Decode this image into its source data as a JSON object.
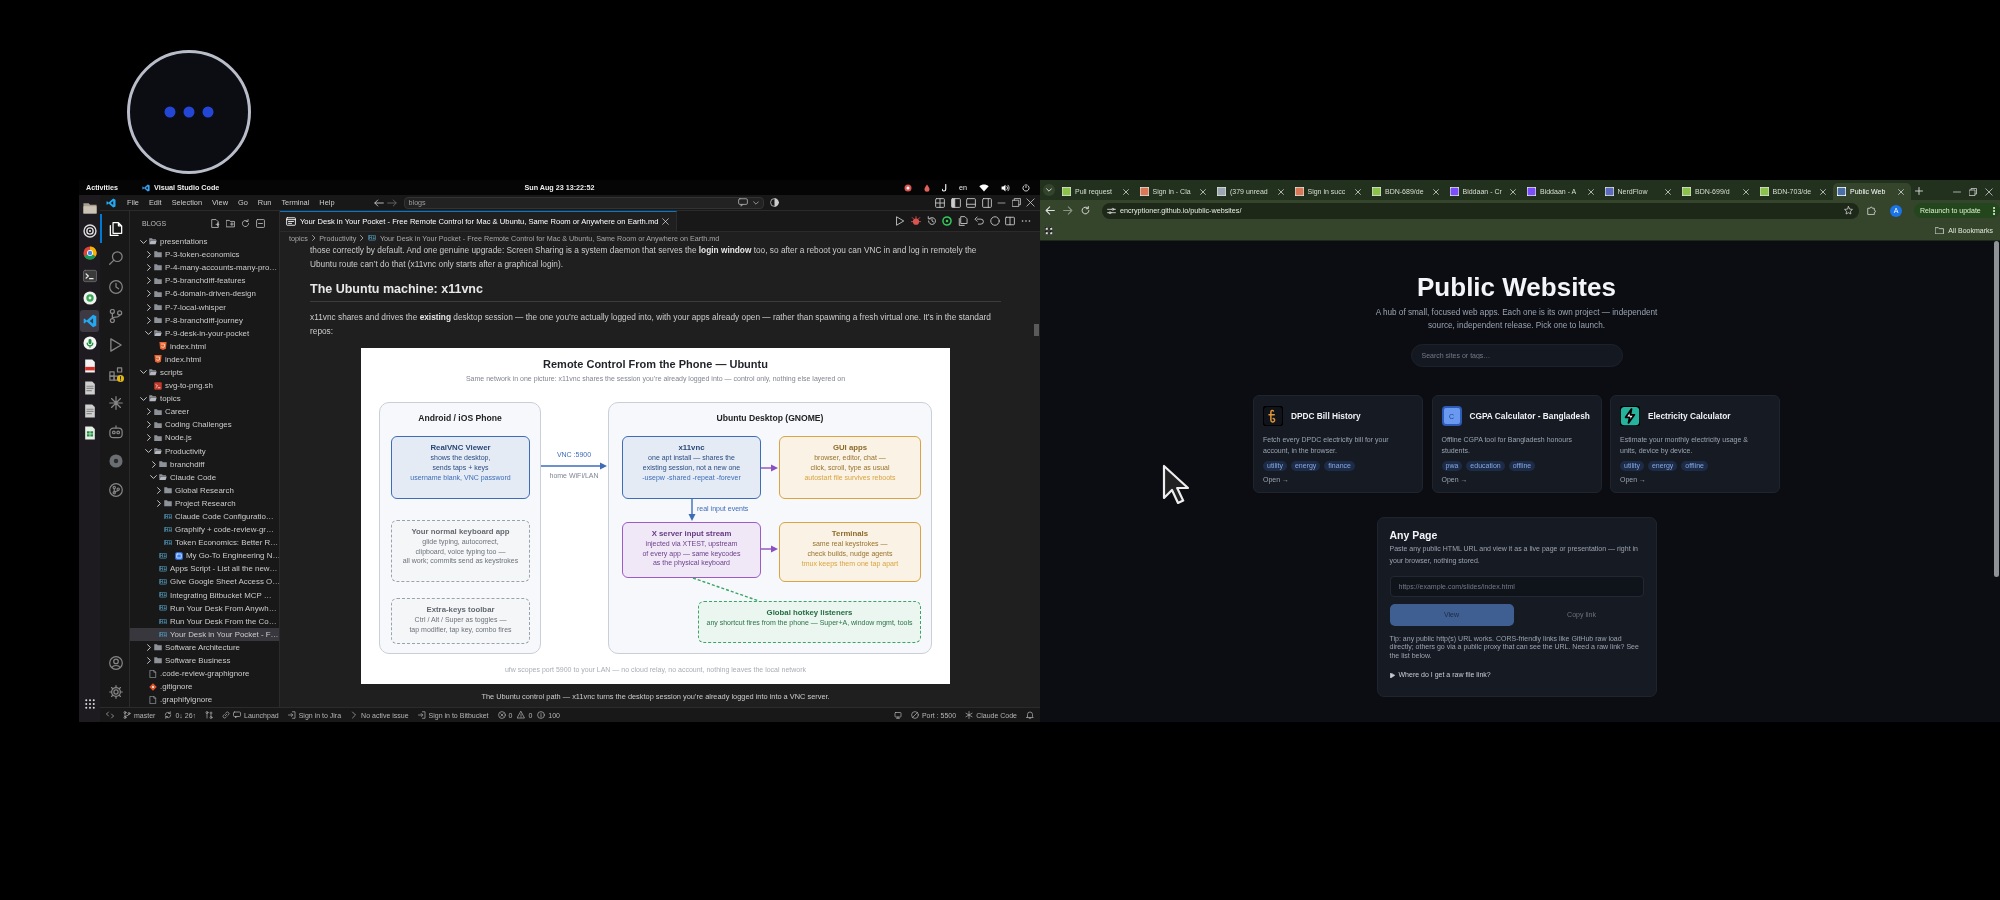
{
  "topbar": {
    "activities": "Activities",
    "app": "Visual Studio Code",
    "clock": "Sun Aug 23  13:22:52",
    "input_source": "en"
  },
  "dock": [
    {
      "kind": "folder",
      "selected": false
    },
    {
      "kind": "ring",
      "selected": false
    },
    {
      "kind": "wheel",
      "selected": false
    },
    {
      "kind": "terminal",
      "selected": false
    },
    {
      "kind": "disc",
      "selected": false
    },
    {
      "kind": "editor",
      "selected": true
    },
    {
      "kind": "mic",
      "selected": false
    },
    {
      "kind": "pdf",
      "selected": false
    },
    {
      "kind": "page",
      "selected": false
    },
    {
      "kind": "page",
      "selected": false
    },
    {
      "kind": "sheet",
      "selected": false
    }
  ],
  "vscode": {
    "menu": [
      "File",
      "Edit",
      "Selection",
      "View",
      "Go",
      "Run",
      "Terminal",
      "Help"
    ],
    "command_center": "blogs",
    "activity_bar": {
      "top": [
        {
          "kind": "explorer",
          "selected": true
        },
        {
          "kind": "search",
          "selected": false
        },
        {
          "kind": "clock",
          "selected": false
        },
        {
          "kind": "branch",
          "selected": false
        },
        {
          "kind": "run",
          "selected": false
        },
        {
          "kind": "extensions",
          "selected": false
        },
        {
          "kind": "asterisk",
          "selected": false
        },
        {
          "kind": "robot",
          "selected": false
        },
        {
          "kind": "disc",
          "selected": false
        },
        {
          "kind": "graph",
          "selected": false
        }
      ],
      "bottom": [
        {
          "kind": "account"
        },
        {
          "kind": "settings"
        }
      ]
    },
    "explorer": {
      "title": "BLOGS",
      "tree": [
        {
          "label": "presentations",
          "kind": "folder",
          "expanded": true,
          "selected": false,
          "children": [
            {
              "label": "P-3-token-economics",
              "kind": "folder",
              "expanded": false,
              "selected": false
            },
            {
              "label": "P-4-many-accounts-many-pro…",
              "kind": "folder",
              "expanded": false,
              "selected": false
            },
            {
              "label": "P-5-branchdiff-features",
              "kind": "folder",
              "expanded": false,
              "selected": false
            },
            {
              "label": "P-6-domain-driven-design",
              "kind": "folder",
              "expanded": false,
              "selected": false
            },
            {
              "label": "P-7-local-whisper",
              "kind": "folder",
              "expanded": false,
              "selected": false
            },
            {
              "label": "P-8-branchdiff-journey",
              "kind": "folder",
              "expanded": false,
              "selected": false
            },
            {
              "label": "P-9-desk-in-your-pocket",
              "kind": "folder",
              "expanded": true,
              "selected": false,
              "children": [
                {
                  "label": "index.html",
                  "kind": "html",
                  "selected": false
                }
              ]
            },
            {
              "label": "index.html",
              "kind": "html",
              "selected": false
            }
          ]
        },
        {
          "label": "scripts",
          "kind": "folder",
          "expanded": true,
          "selected": false,
          "children": [
            {
              "label": "svg-to-png.sh",
              "kind": "shell",
              "selected": false
            }
          ]
        },
        {
          "label": "topics",
          "kind": "folder",
          "expanded": true,
          "selected": false,
          "children": [
            {
              "label": "Career",
              "kind": "folder",
              "expanded": false,
              "selected": false
            },
            {
              "label": "Coding Challenges",
              "kind": "folder",
              "expanded": false,
              "selected": false
            },
            {
              "label": "Node.js",
              "kind": "folder",
              "expanded": false,
              "selected": false
            },
            {
              "label": "Productivity",
              "kind": "folder",
              "expanded": true,
              "selected": false,
              "children": [
                {
                  "label": "branchdiff",
                  "kind": "folder",
                  "expanded": false,
                  "selected": false
                },
                {
                  "label": "Claude Code",
                  "kind": "folder",
                  "expanded": true,
                  "selected": false,
                  "children": [
                    {
                      "label": "Global Research",
                      "kind": "folder",
                      "expanded": false,
                      "selected": false
                    },
                    {
                      "label": "Project Research",
                      "kind": "folder",
                      "expanded": false,
                      "selected": false
                    },
                    {
                      "label": "Claude Code Configuratio…",
                      "kind": "markdown",
                      "selected": false
                    },
                    {
                      "label": "Graphify + code-review-gr…",
                      "kind": "markdown",
                      "selected": false
                    },
                    {
                      "label": "Token Economics: Better R…",
                      "kind": "markdown",
                      "selected": false
                    }
                  ]
                },
                {
                  "label": "My Go-To Engineering N…",
                  "kind": "markdown",
                  "emoji": true,
                  "selected": false
                },
                {
                  "label": "Apps Script - List all the new…",
                  "kind": "markdown",
                  "selected": false
                },
                {
                  "label": "Give Google Sheet Access O…",
                  "kind": "markdown",
                  "selected": false
                },
                {
                  "label": "Integrating Bitbucket MCP …",
                  "kind": "markdown",
                  "selected": false
                },
                {
                  "label": "Run Your Desk From Anywh…",
                  "kind": "markdown",
                  "selected": false
                },
                {
                  "label": "Run Your Desk From the Co…",
                  "kind": "markdown",
                  "selected": false
                },
                {
                  "label": "Your Desk in Your Pocket - F…",
                  "kind": "markdown",
                  "selected": true
                }
              ]
            },
            {
              "label": "Software Architecture",
              "kind": "folder",
              "expanded": false,
              "selected": false
            },
            {
              "label": "Software Business",
              "kind": "folder",
              "expanded": false,
              "selected": false
            }
          ]
        },
        {
          "label": ".code-review-graphignore",
          "kind": "text",
          "selected": false
        },
        {
          "label": ".gitignore",
          "kind": "git",
          "selected": false
        },
        {
          "label": ".graphifyignore",
          "kind": "text",
          "selected": false
        }
      ]
    },
    "tab": {
      "title": "Your Desk in Your Pocket - Free Remote Control for Mac & Ubuntu, Same Room or Anywhere on Earth.md",
      "selected": true
    },
    "breadcrumb": [
      "topics",
      "Productivity",
      "Your Desk in Your Pocket - Free Remote Control for Mac & Ubuntu, Same Room or Anywhere on Earth.md"
    ],
    "preview": [
      {
        "kind": "paragraph",
        "text": "those correctly by default. And one genuine upgrade: Screen Sharing is a system daemon that serves the **login window** too, so after a reboot you can VNC in and log in remotely the Ubuntu route can’t do that (x11vnc only starts after a graphical login)."
      },
      {
        "kind": "heading",
        "text": "The Ubuntu machine: x11vnc"
      },
      {
        "kind": "paragraph",
        "text": "x11vnc shares and drives the **existing** desktop session — the one you’re actually logged into, with your apps already open — rather than spawning a fresh virtual one. It’s in the standard repos:"
      },
      {
        "kind": "figure",
        "caption": "The Ubuntu control path — x11vnc turns the desktop session you’re already logged into into a VNC server.",
        "diagram": {
          "title": "Remote Control From the Phone — Ubuntu",
          "subtitle": "Same network in one picture: x11vnc shares the session you’re already logged into — control only, nothing else layered on",
          "groups": [
            {
              "title": "Android / iOS Phone"
            },
            {
              "title": "Ubuntu Desktop (GNOME)"
            }
          ],
          "nodes": [
            {
              "kind": "solid",
              "color": "#3d6db8",
              "title": "RealVNC Viewer",
              "text": "shows the desktop,\nsends taps + keys",
              "note": "username blank, VNC password"
            },
            {
              "kind": "dashed",
              "color": "#9aa3ad",
              "title": "Your normal keyboard app",
              "text": "glide typing, autocorrect,\nclipboard, voice typing too —\nall work; commits send as keystrokes"
            },
            {
              "kind": "dashed",
              "color": "#9aa3ad",
              "title": "Extra-keys toolbar",
              "text": "Ctrl / Alt / Super as toggles —\ntap modifier, tap key, combo fires"
            },
            {
              "kind": "solid",
              "color": "#3d6db8",
              "title": "x11vnc",
              "text": "one apt install — shares the\nexisting session, not a new one",
              "note": "-usepw -shared -repeat -forever"
            },
            {
              "kind": "solid",
              "color": "#d9a441",
              "title": "GUI apps",
              "text": "browser, editor, chat —\nclick, scroll, type as usual",
              "note": "autostart file survives reboots"
            },
            {
              "kind": "solid",
              "color": "#9b5bc9",
              "title": "X server input stream",
              "text": "injected via XTEST, upstream\nof every app — same keycodes\nas the physical keyboard"
            },
            {
              "kind": "solid",
              "color": "#d9a441",
              "title": "Terminals",
              "text": "same real keystrokes —\ncheck builds, nudge agents",
              "note": "tmux keeps them one tap apart"
            },
            {
              "kind": "dashed",
              "color": "#3aa565",
              "title": "Global hotkey listeners",
              "text": "any shortcut fires from the phone — Super+A, window mgmt, tools"
            }
          ],
          "edges": [
            {
              "kind": "solid",
              "color": "#3d6db8",
              "label": "VNC :5900",
              "sublabel": "home WiFi/LAN"
            },
            {
              "kind": "solid",
              "color": "#8a4fc0"
            },
            {
              "kind": "solid",
              "color": "#3d6db8",
              "label": "real input events"
            },
            {
              "kind": "solid",
              "color": "#8a4fc0"
            },
            {
              "kind": "dashed",
              "color": "#3aa565"
            }
          ],
          "footer": "ufw scopes port 5900 to your LAN — no cloud relay, no account, nothing leaves the local network"
        }
      }
    ],
    "status_bar": {
      "left": [
        {
          "kind": "remote"
        },
        {
          "kind": "branch",
          "text": "master"
        },
        {
          "kind": "sync",
          "text": "0↓ 26↑"
        },
        {
          "kind": "graph"
        },
        {
          "kind": "launchpad",
          "text": "Launchpad"
        },
        {
          "kind": "signin",
          "text": "Sign in to Jira"
        },
        {
          "kind": "issue",
          "text": "No active issue"
        },
        {
          "kind": "signin",
          "text": "Sign in to Bitbucket"
        },
        {
          "kind": "problems",
          "errors": "0",
          "warnings": "0",
          "infos": "100"
        }
      ],
      "right": [
        {
          "kind": "broadcast"
        },
        {
          "kind": "port",
          "text": "Port : 5500"
        },
        {
          "kind": "asterisk",
          "text": "Claude Code"
        },
        {
          "kind": "bell"
        }
      ]
    }
  },
  "browser": {
    "tabs": [
      {
        "title": "Pull request",
        "color": "#8bc34a",
        "selected": false
      },
      {
        "title": "Sign in - Cla",
        "color": "#d97757",
        "selected": false
      },
      {
        "title": "(379 unread",
        "color": "#9aa6b2",
        "selected": false
      },
      {
        "title": "Sign in succ",
        "color": "#d97757",
        "selected": false
      },
      {
        "title": "BDN-689/de",
        "color": "#8bc34a",
        "selected": false
      },
      {
        "title": "Biddaan - Cr",
        "color": "#7c4dff",
        "selected": false
      },
      {
        "title": "Biddaan - A",
        "color": "#7c4dff",
        "selected": false
      },
      {
        "title": "NerdFlow",
        "color": "#5c6bc0",
        "selected": false
      },
      {
        "title": "BDN-699/d",
        "color": "#8bc34a",
        "selected": false
      },
      {
        "title": "BDN-703/de",
        "color": "#8bc34a",
        "selected": false
      },
      {
        "title": "Public Web",
        "color": "#4a6fa5",
        "selected": true
      }
    ],
    "address": "encryptioner.github.io/public-websites/",
    "avatar": "A",
    "relaunch": "Relaunch to update",
    "bookmarks_folder": "All Bookmarks",
    "page": {
      "title": "Public Websites",
      "subtitle": "A hub of small, focused web apps. Each one is its own project — independent source, independent release. Pick one to launch.",
      "search": {
        "placeholder": "Search sites or tags…"
      },
      "cards": [
        {
          "title": "DPDC Bill History",
          "description": "Fetch every DPDC electricity bill for your account, in the browser.",
          "tags": [
            "utility",
            "energy",
            "finance"
          ],
          "link": "Open →"
        },
        {
          "badge": "C",
          "title": "CGPA Calculator - Bangladesh",
          "description": "Offline CGPA tool for Bangladesh honours students.",
          "tags": [
            "pwa",
            "education",
            "offline"
          ],
          "link": "Open →"
        },
        {
          "title": "Electricity Calculator",
          "description": "Estimate your monthly electricity usage & units, device by device.",
          "tags": [
            "utility",
            "energy",
            "offline"
          ],
          "link": "Open →"
        }
      ],
      "any_page": {
        "title": "Any Page",
        "description": "Paste any public HTML URL and view it as a live page or presentation — right in your browser, nothing stored.",
        "input": {
          "placeholder": "https://example.com/slides/index.html"
        },
        "buttons": [
          "View",
          "Copy link"
        ],
        "tip": "Tip: any public http(s) URL works. CORS-friendly links like GitHub raw load directly; others go via a public proxy that can see the URL. Need a raw link? See the list below.",
        "details": {
          "summary": "Where do I get a raw file link?",
          "expanded": false
        }
      }
    }
  }
}
